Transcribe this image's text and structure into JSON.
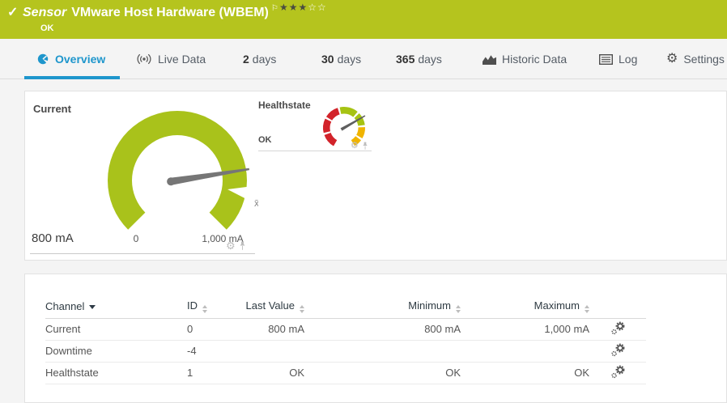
{
  "header": {
    "check": "✓",
    "kind": "Sensor",
    "title": "VMware Host Hardware (WBEM)",
    "flag": "⚐",
    "stars_filled": "★★★",
    "stars_empty": "☆☆",
    "status": "OK"
  },
  "tabs": [
    {
      "bold": "",
      "label": "Overview"
    },
    {
      "bold": "",
      "label": "Live Data"
    },
    {
      "bold": "2",
      "label": "days"
    },
    {
      "bold": "30",
      "label": "days"
    },
    {
      "bold": "365",
      "label": "days"
    },
    {
      "bold": "",
      "label": "Historic Data"
    },
    {
      "bold": "",
      "label": "Log"
    },
    {
      "bold": "",
      "label": "Settings"
    }
  ],
  "gauges": {
    "current": {
      "title": "Current",
      "value": 800,
      "min": 0,
      "max": 1000,
      "unit": "mA",
      "value_label": "800 mA",
      "scale_min_label": "0",
      "scale_max_label": "1,000 mA",
      "avg_marker": "x̄",
      "color": "#a9c21b"
    },
    "healthstate": {
      "title": "Healthstate",
      "value_label": "OK",
      "segment_colors": {
        "error": "#d2232a",
        "warning": "#f0b400",
        "ok": "#a6c313"
      }
    }
  },
  "table": {
    "headers": {
      "channel": "Channel",
      "id": "ID",
      "last_value": "Last Value",
      "minimum": "Minimum",
      "maximum": "Maximum"
    },
    "rows": [
      {
        "channel": "Current",
        "id": "0",
        "last_value": "800 mA",
        "minimum": "800 mA",
        "maximum": "1,000 mA"
      },
      {
        "channel": "Downtime",
        "id": "-4",
        "last_value": "",
        "minimum": "",
        "maximum": ""
      },
      {
        "channel": "Healthstate",
        "id": "1",
        "last_value": "OK",
        "minimum": "OK",
        "maximum": "OK"
      }
    ]
  },
  "colors": {
    "brand_green": "#b5c41e",
    "gauge_green": "#a9c21b",
    "accent_blue": "#1e96cc",
    "status_red": "#d2232a",
    "status_yellow": "#f0b400"
  }
}
